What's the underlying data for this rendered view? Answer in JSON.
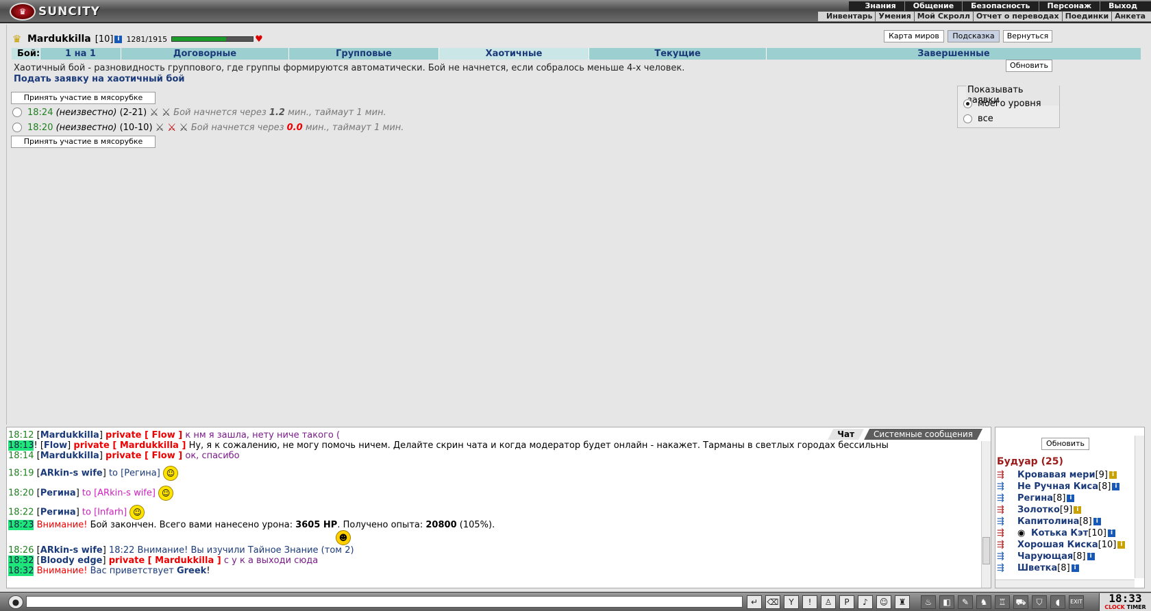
{
  "logo": {
    "text": "SUNCITY"
  },
  "top_menu_primary": [
    "Знания",
    "Общение",
    "Безопасность",
    "Персонаж",
    "Выход"
  ],
  "top_menu_secondary": [
    "Инвентарь",
    "Умения",
    "Мой Скролл",
    "Отчет о переводах",
    "Поединки",
    "Анкета"
  ],
  "character": {
    "name": "Mardukkilla",
    "level": "[10]",
    "info": "i",
    "hp": "1281/1915",
    "hp_fraction": 0.669
  },
  "header_buttons": {
    "map": "Карта миров",
    "hint": "Подсказка",
    "back": "Вернуться"
  },
  "fight_tabs": {
    "label": "Бой:",
    "items": [
      "1 на 1",
      "Договорные",
      "Групповые",
      "Хаотичные",
      "Текущие",
      "Завершенные"
    ],
    "selected": "Хаотичные"
  },
  "description": "Хаотичный бой - разновидность группового, где группы формируются автоматически. Бой не начнется, если собралось меньше 4-х человек.",
  "submit_link": "Подать заявку на хаотичный бой",
  "refresh_button": "Обновить",
  "join_button": "Принять участие в мясорубке",
  "battles": [
    {
      "time": "18:24",
      "who": "(неизвестно)",
      "levels": "(2-21)",
      "status_a": "Бой начнется через",
      "minutes": "1.2",
      "status_b": "мин., таймаут 1 мин."
    },
    {
      "time": "18:20",
      "who": "(неизвестно)",
      "levels": "(10-10)",
      "status_a": "Бой начнется через",
      "minutes": "0.0",
      "status_b": "мин., таймаут 1 мин."
    }
  ],
  "show_requests": {
    "title": "Показывать заявки",
    "opt_mine": "моего уровня",
    "opt_all": "все"
  },
  "chat_tabs": {
    "chat": "Чат",
    "system": "Системные сообщения"
  },
  "chat": {
    "m1": {
      "time": "18:12",
      "from": "Mardukkilla",
      "priv": "private [ Flow ]",
      "text": "к нм я зашла, нету ниче такого ("
    },
    "m2": {
      "time": "18:13",
      "from": "Flow",
      "priv": "private [ Mardukkilla ]",
      "text": "Ну, я к сожалению, не могу помочь ничем. Делайте скрин чата и когда модератор будет онлайн - накажет. Тарманы в светлых городах бессильны"
    },
    "m3": {
      "time": "18:14",
      "from": "Mardukkilla",
      "priv": "private [ Flow ]",
      "text": "ок, спасибо"
    },
    "m4": {
      "time": "18:19",
      "from": "ARkin-s wife",
      "to": "to [Регина]"
    },
    "m5": {
      "time": "18:20",
      "from": "Регина",
      "to": "to [ARkin-s wife]"
    },
    "m6": {
      "time": "18:22",
      "from": "Регина",
      "to": "to [Infarh]"
    },
    "m7": {
      "time": "18:23",
      "warn": "Внимание!",
      "text_a": "Бой закончен. Всего вами нанесено урона:",
      "dmg": "3605 HP",
      "text_b": ". Получено опыта:",
      "exp": "20800",
      "text_c": "(105%)."
    },
    "m8": {
      "time": "18:26",
      "from": "ARkin-s wife",
      "text": "18:22 Внимание! Вы изучили Тайное Знание (том 2)"
    },
    "m9": {
      "time": "18:32",
      "from": "Bloody edge",
      "priv": "private [ Mardukkilla ]",
      "text": "с у к а выходи сюда"
    },
    "m10": {
      "time": "18:32",
      "warn": "Внимание!",
      "text": "Вас приветствует",
      "name": "Greek",
      "end": "!"
    }
  },
  "room": {
    "refresh": "Обновить",
    "title": "Будуар (25)",
    "users": [
      {
        "name": "Кровавая мери",
        "level": "[9]"
      },
      {
        "name": "Не Ручная Киса",
        "level": "[8]"
      },
      {
        "name": "Регина",
        "level": "[8]"
      },
      {
        "name": "Золотко",
        "level": "[9]"
      },
      {
        "name": "Капитолина",
        "level": "[8]"
      },
      {
        "name": "Котька Кэт",
        "level": "[10]"
      },
      {
        "name": "Хорошая Киска",
        "level": "[10]"
      },
      {
        "name": "Чарующая",
        "level": "[8]"
      },
      {
        "name": "Шветка",
        "level": "[8]"
      }
    ]
  },
  "clock": {
    "time": "18:33",
    "label_clock": "CLOCK",
    "label_timer": "TIMER",
    "exit": "EXIT"
  }
}
